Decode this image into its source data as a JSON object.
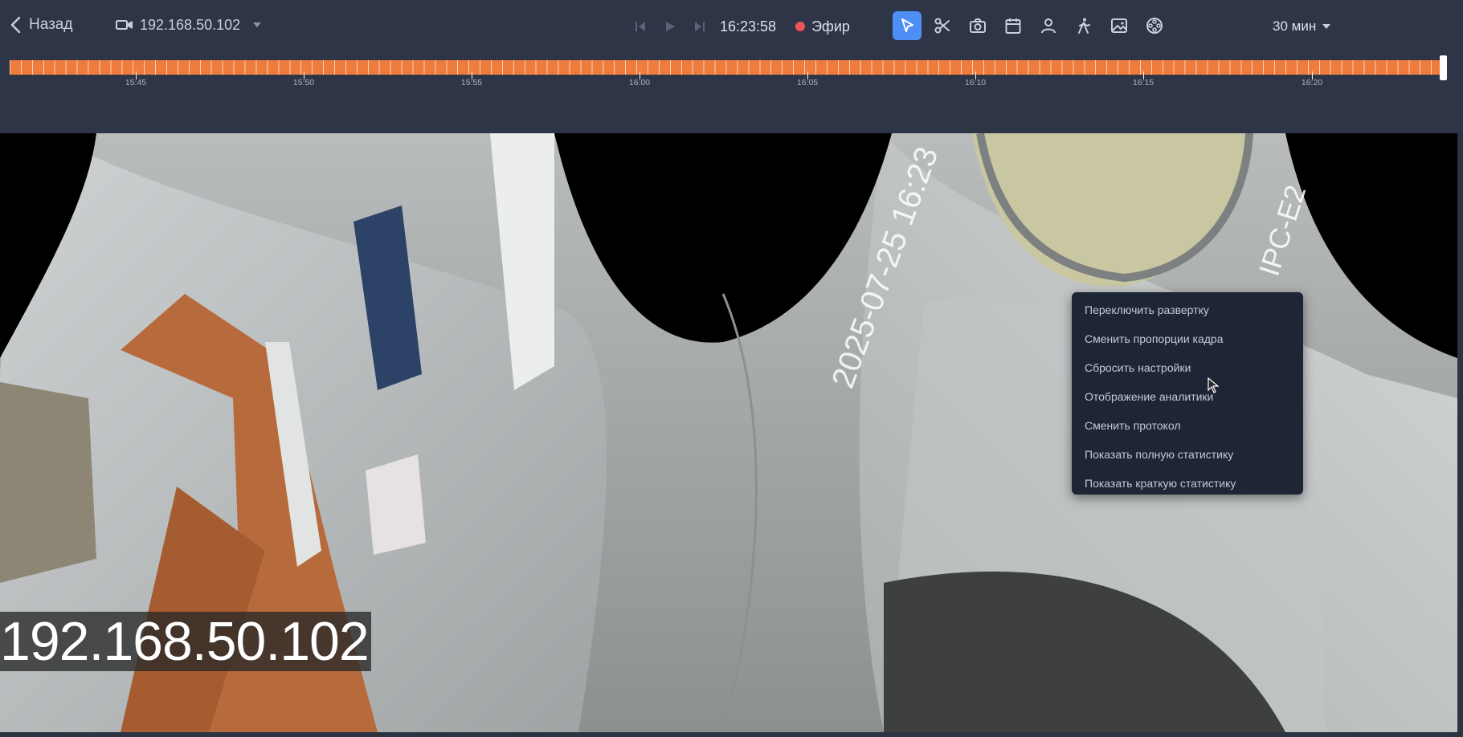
{
  "header": {
    "back_label": "Назад",
    "camera_name": "192.168.50.102",
    "time": "16:23:58",
    "live_label": "Эфир",
    "range_label": "30 мин",
    "icons": {
      "back": "chevron-left-icon",
      "camera": "video-camera-icon",
      "skip_back": "skip-back-icon",
      "play": "play-icon",
      "skip_forward": "skip-forward-icon"
    },
    "live_color": "#f0525c"
  },
  "toolbar": {
    "active_color": "#4e8ff5",
    "tools": [
      {
        "name": "pointer-icon",
        "active": true
      },
      {
        "name": "scissors-icon",
        "active": false
      },
      {
        "name": "camera-snapshot-icon",
        "active": false
      },
      {
        "name": "calendar-icon",
        "active": false
      },
      {
        "name": "person-icon",
        "active": false
      },
      {
        "name": "walking-person-icon",
        "active": false
      },
      {
        "name": "image-icon",
        "active": false
      },
      {
        "name": "film-reel-icon",
        "active": false
      }
    ]
  },
  "timeline": {
    "track_color": "#ee7c3c",
    "labels": [
      "15:45",
      "15:50",
      "15:55",
      "16:00",
      "16:05",
      "16:10",
      "16:15",
      "16:20"
    ]
  },
  "video": {
    "overlay_text": "192.168.50.102"
  },
  "context_menu": {
    "items": [
      "Переключить развертку",
      "Сменить пропорции кадра",
      "Сбросить настройки",
      "Отображение аналитики",
      "Сменить протокол",
      "Показать полную статистику",
      "Показать краткую статистику"
    ]
  }
}
